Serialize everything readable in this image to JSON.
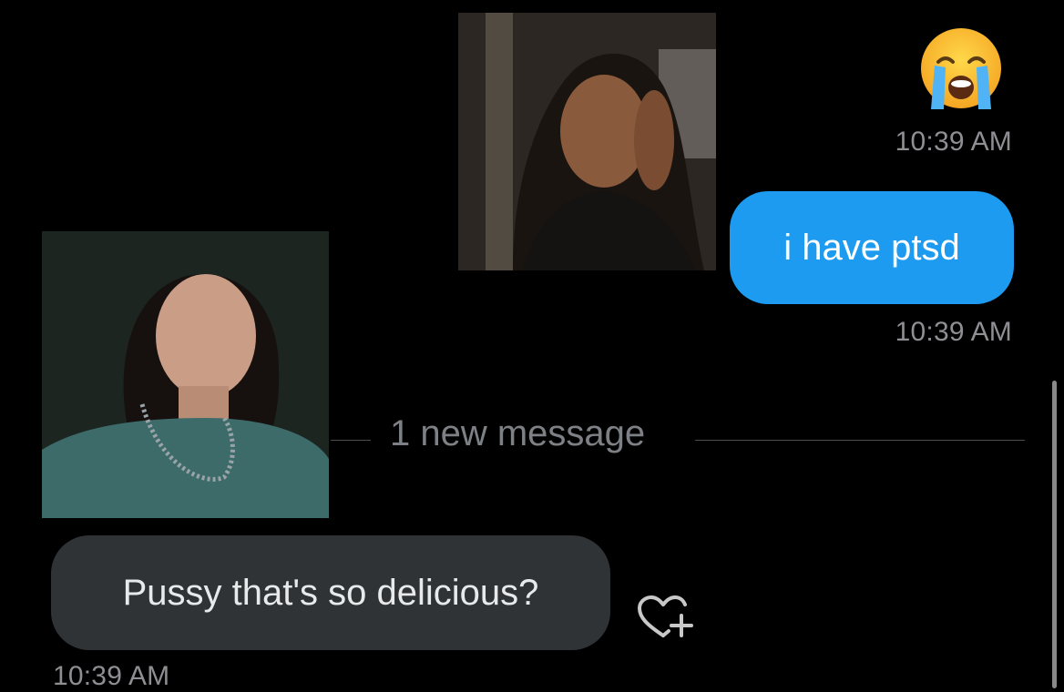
{
  "messages": [
    {
      "side": "sent",
      "type": "emoji",
      "content": "😭",
      "timestamp": "10:39 AM"
    },
    {
      "side": "sent",
      "type": "text",
      "content": "i have ptsd",
      "timestamp": "10:39 AM"
    },
    {
      "side": "received",
      "type": "text",
      "content": "Pussy that's so delicious?",
      "timestamp": "10:39 AM"
    }
  ],
  "divider": {
    "label": "1 new message"
  },
  "icons": {
    "react": "heart-plus-icon",
    "emoji": "loudly-crying-face-icon"
  },
  "colors": {
    "background": "#000000",
    "sent_bubble": "#1d9bf0",
    "received_bubble": "#2f3336",
    "timestamp": "#8e8e93"
  }
}
